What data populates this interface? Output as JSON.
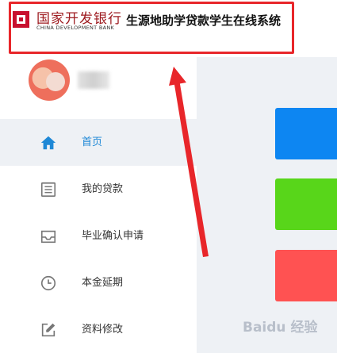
{
  "header": {
    "bank_name_cn": "国家开发银行",
    "bank_name_en": "CHINA DEVELOPMENT BANK",
    "system_title": "生源地助学贷款学生在线系统"
  },
  "nav": {
    "items": [
      {
        "label": "首页",
        "icon": "home-icon",
        "active": true
      },
      {
        "label": "我的贷款",
        "icon": "list-icon",
        "active": false
      },
      {
        "label": "毕业确认申请",
        "icon": "inbox-icon",
        "active": false
      },
      {
        "label": "本金延期",
        "icon": "clock-icon",
        "active": false
      },
      {
        "label": "资料修改",
        "icon": "edit-icon",
        "active": false
      }
    ]
  },
  "colors": {
    "accent": "#1e88d6",
    "highlight_border": "#e8262a",
    "tile_blue": "#0d86f2",
    "tile_green": "#58d61a",
    "tile_red": "#ff5252"
  },
  "watermark": "Baidu 经验"
}
